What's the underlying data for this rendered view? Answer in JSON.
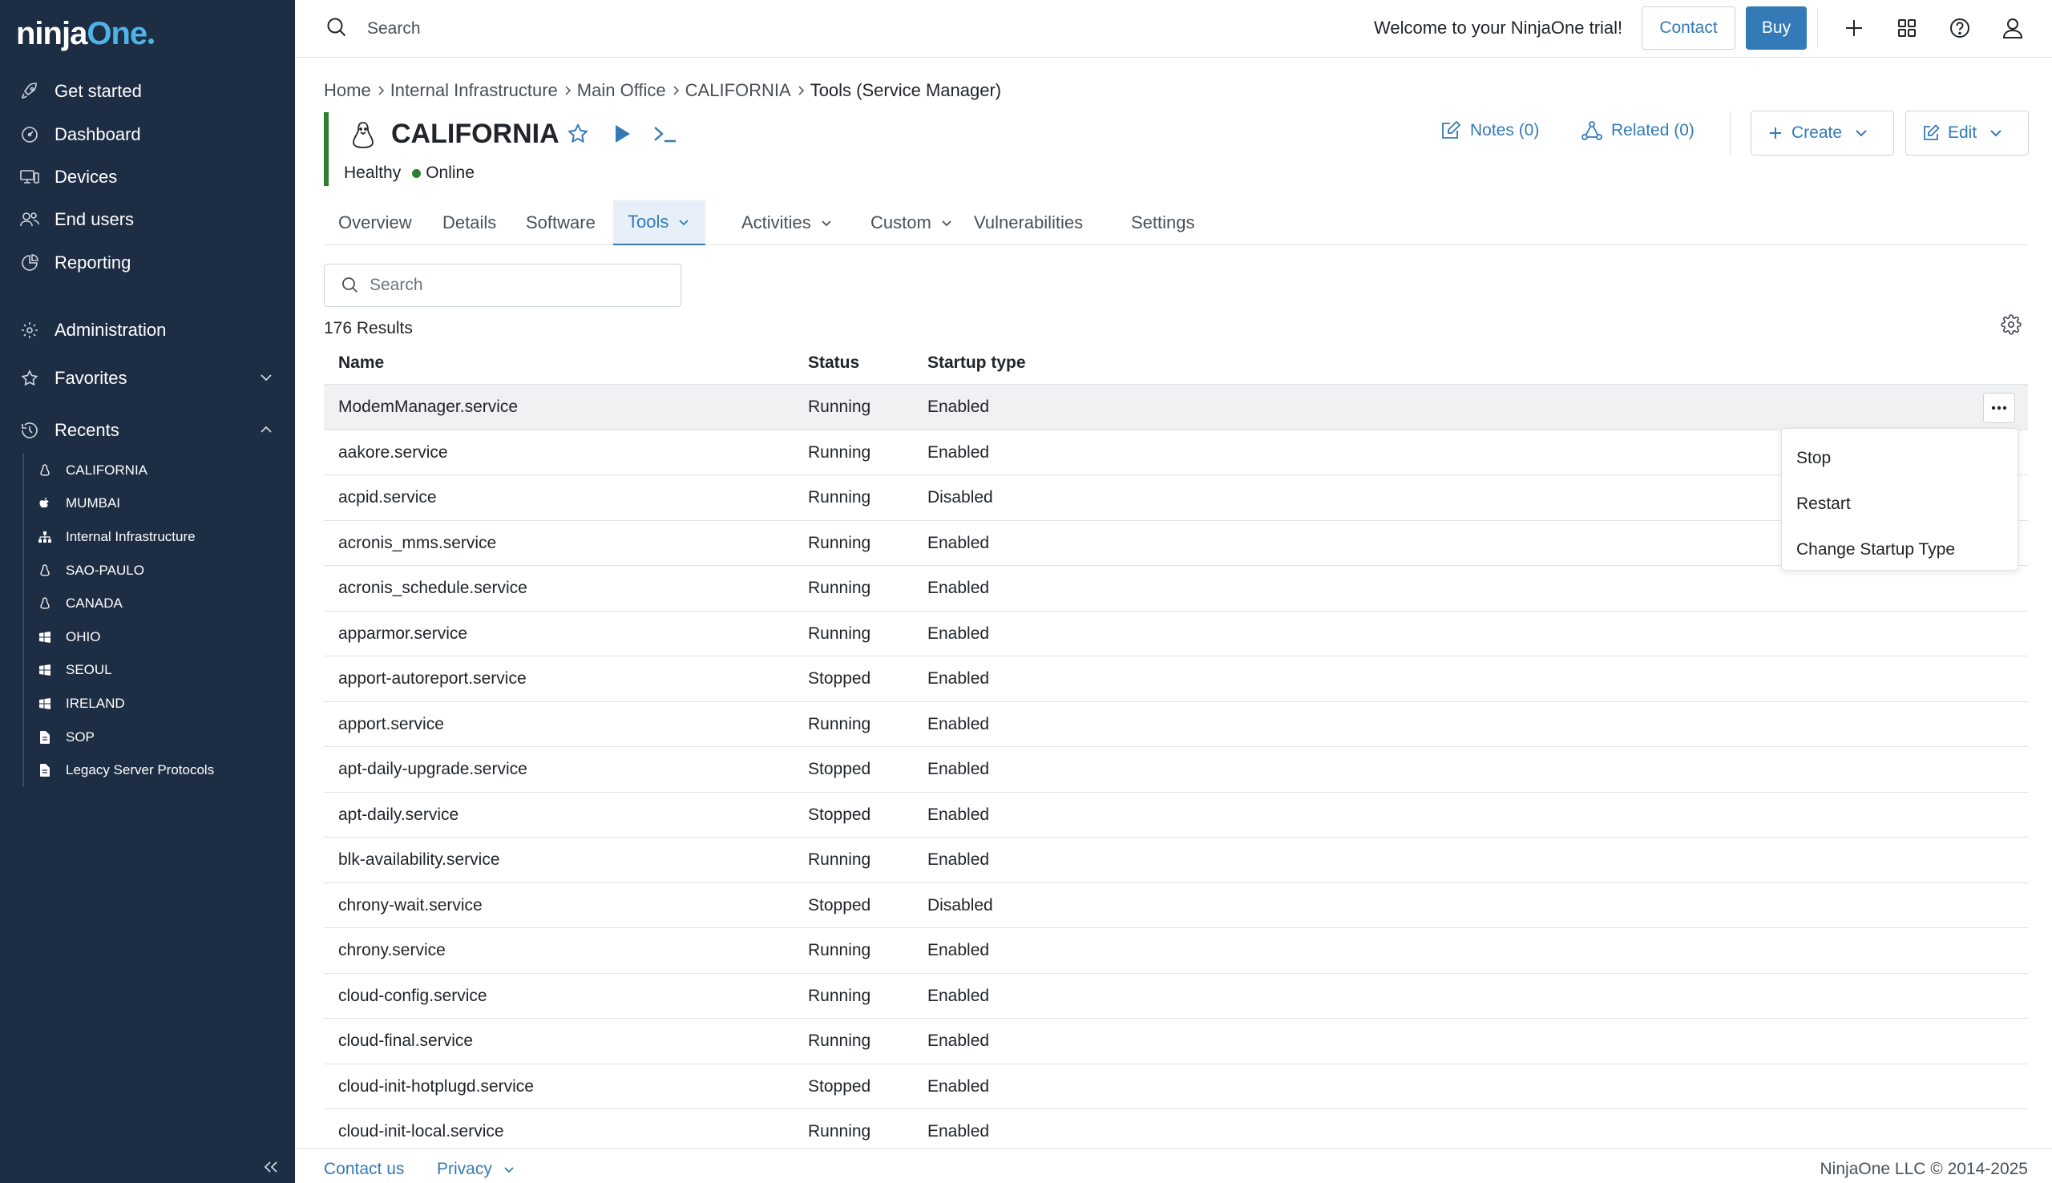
{
  "brand": {
    "logo_a": "ninja",
    "logo_b": "One"
  },
  "sidebar": {
    "items": [
      {
        "label": "Get started",
        "icon": "rocket-icon"
      },
      {
        "label": "Dashboard",
        "icon": "speedometer-icon"
      },
      {
        "label": "Devices",
        "icon": "devices-icon"
      },
      {
        "label": "End users",
        "icon": "users-icon"
      },
      {
        "label": "Reporting",
        "icon": "chart-pie-icon"
      },
      {
        "label": "Administration",
        "icon": "gear-icon"
      },
      {
        "label": "Favorites",
        "icon": "star-icon"
      },
      {
        "label": "Recents",
        "icon": "history-icon"
      }
    ],
    "recents": [
      {
        "label": "CALIFORNIA",
        "icon": "linux-icon"
      },
      {
        "label": "MUMBAI",
        "icon": "apple-icon"
      },
      {
        "label": "Internal Infrastructure",
        "icon": "org-icon"
      },
      {
        "label": "SAO-PAULO",
        "icon": "linux-icon"
      },
      {
        "label": "CANADA",
        "icon": "linux-icon"
      },
      {
        "label": "OHIO",
        "icon": "windows-icon"
      },
      {
        "label": "SEOUL",
        "icon": "windows-icon"
      },
      {
        "label": "IRELAND",
        "icon": "windows-icon"
      },
      {
        "label": "SOP",
        "icon": "document-icon"
      },
      {
        "label": "Legacy Server Protocols",
        "icon": "document-icon"
      }
    ]
  },
  "topbar": {
    "search_placeholder": "Search",
    "welcome": "Welcome to your NinjaOne trial!",
    "contact": "Contact",
    "buy": "Buy"
  },
  "breadcrumb": [
    "Home",
    "Internal Infrastructure",
    "Main Office",
    "CALIFORNIA",
    "Tools (Service Manager)"
  ],
  "device": {
    "name": "CALIFORNIA",
    "health": "Healthy",
    "status": "Online",
    "notes": "Notes (0)",
    "related": "Related (0)",
    "create": "Create",
    "edit": "Edit"
  },
  "tabs": [
    "Overview",
    "Details",
    "Software",
    "Tools",
    "Activities",
    "Custom",
    "Vulnerabilities",
    "Settings"
  ],
  "list": {
    "search_placeholder": "Search",
    "results": "176 Results",
    "columns": [
      "Name",
      "Status",
      "Startup type"
    ],
    "rows": [
      [
        "ModemManager.service",
        "Running",
        "Enabled"
      ],
      [
        "aakore.service",
        "Running",
        "Enabled"
      ],
      [
        "acpid.service",
        "Running",
        "Disabled"
      ],
      [
        "acronis_mms.service",
        "Running",
        "Enabled"
      ],
      [
        "acronis_schedule.service",
        "Running",
        "Enabled"
      ],
      [
        "apparmor.service",
        "Running",
        "Enabled"
      ],
      [
        "apport-autoreport.service",
        "Stopped",
        "Enabled"
      ],
      [
        "apport.service",
        "Running",
        "Enabled"
      ],
      [
        "apt-daily-upgrade.service",
        "Stopped",
        "Enabled"
      ],
      [
        "apt-daily.service",
        "Stopped",
        "Enabled"
      ],
      [
        "blk-availability.service",
        "Running",
        "Enabled"
      ],
      [
        "chrony-wait.service",
        "Stopped",
        "Disabled"
      ],
      [
        "chrony.service",
        "Running",
        "Enabled"
      ],
      [
        "cloud-config.service",
        "Running",
        "Enabled"
      ],
      [
        "cloud-final.service",
        "Running",
        "Enabled"
      ],
      [
        "cloud-init-hotplugd.service",
        "Stopped",
        "Enabled"
      ],
      [
        "cloud-init-local.service",
        "Running",
        "Enabled"
      ]
    ]
  },
  "context_menu": [
    "Stop",
    "Restart",
    "Change Startup Type"
  ],
  "footer": {
    "contact": "Contact us",
    "privacy": "Privacy",
    "copyright": "NinjaOne LLC © 2014-2025"
  },
  "colors": {
    "sidebar": "#1d2d44",
    "accent": "#337ab7",
    "online": "#2e7d32"
  }
}
